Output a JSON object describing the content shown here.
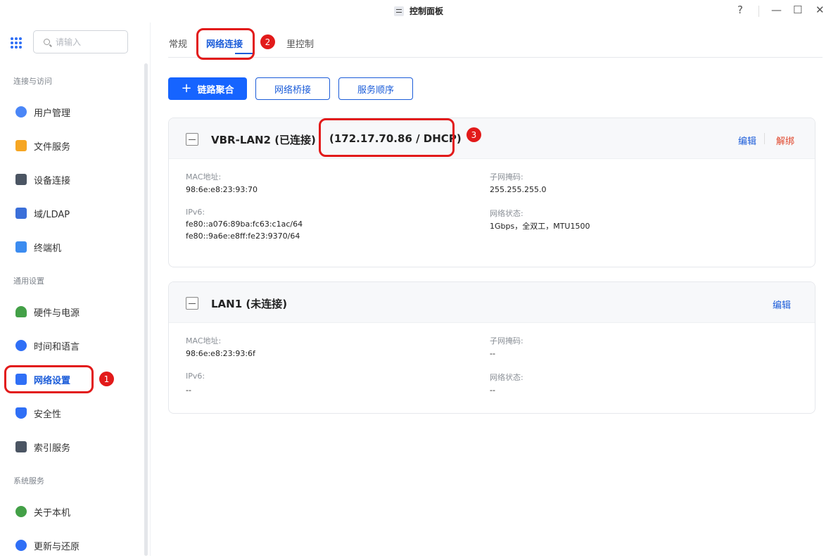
{
  "window": {
    "title": "控制面板",
    "help_icon": "?",
    "minimize_icon": "—",
    "maximize_icon": "☐",
    "close_icon": "✕"
  },
  "sidebar": {
    "search_placeholder": "请输入",
    "sections": [
      "连接与访问",
      "通用设置",
      "系统服务"
    ],
    "items": [
      {
        "label": "用户管理",
        "icon": "user-icon",
        "color": "#4a86f7"
      },
      {
        "label": "文件服务",
        "icon": "folder-icon",
        "color": "#f6a623"
      },
      {
        "label": "设备连接",
        "icon": "device-icon",
        "color": "#4b5563"
      },
      {
        "label": "域/LDAP",
        "icon": "domain-icon",
        "color": "#3b6fd9"
      },
      {
        "label": "终端机",
        "icon": "terminal-icon",
        "color": "#3c8cf0"
      },
      {
        "label": "硬件与电源",
        "icon": "battery-icon",
        "color": "#43a047"
      },
      {
        "label": "时间和语言",
        "icon": "globe-icon",
        "color": "#2f6ff6"
      },
      {
        "label": "网络设置",
        "icon": "network-icon",
        "color": "#2f6ff6"
      },
      {
        "label": "安全性",
        "icon": "shield-icon",
        "color": "#2f6ff6"
      },
      {
        "label": "索引服务",
        "icon": "index-icon",
        "color": "#4b5563"
      },
      {
        "label": "关于本机",
        "icon": "info-icon",
        "color": "#43a047"
      },
      {
        "label": "更新与还原",
        "icon": "refresh-icon",
        "color": "#2f6ff6"
      }
    ]
  },
  "tabs": [
    "常规",
    "网络连接",
    "流量控制"
  ],
  "tab_visible_suffix": "里控制",
  "annotations": [
    "1",
    "2",
    "3"
  ],
  "toolbar": {
    "add_label": "链路聚合",
    "bridge_label": "网络桥接",
    "order_label": "服务顺序"
  },
  "cards": [
    {
      "title": "VBR-LAN2 (已连接)",
      "ip": "(172.17.70.86 / DHCP)",
      "edit_label": "编辑",
      "unbind_label": "解绑",
      "mac_label": "MAC地址:",
      "mac_value": "98:6e:e8:23:93:70",
      "mask_label": "子网掩码:",
      "mask_value": "255.255.255.0",
      "ipv6_label": "IPv6:",
      "ipv6_values": [
        "fe80::a076:89ba:fc63:c1ac/64",
        "fe80::9a6e:e8ff:fe23:9370/64"
      ],
      "status_label": "网络状态:",
      "status_value": "1Gbps，全双工，MTU1500"
    },
    {
      "title": "LAN1 (未连接)",
      "edit_label": "编辑",
      "mac_label": "MAC地址:",
      "mac_value": "98:6e:e8:23:93:6f",
      "mask_label": "子网掩码:",
      "mask_value": "--",
      "ipv6_label": "IPv6:",
      "ipv6_value": "--",
      "status_label": "网络状态:",
      "status_value": "--"
    }
  ]
}
